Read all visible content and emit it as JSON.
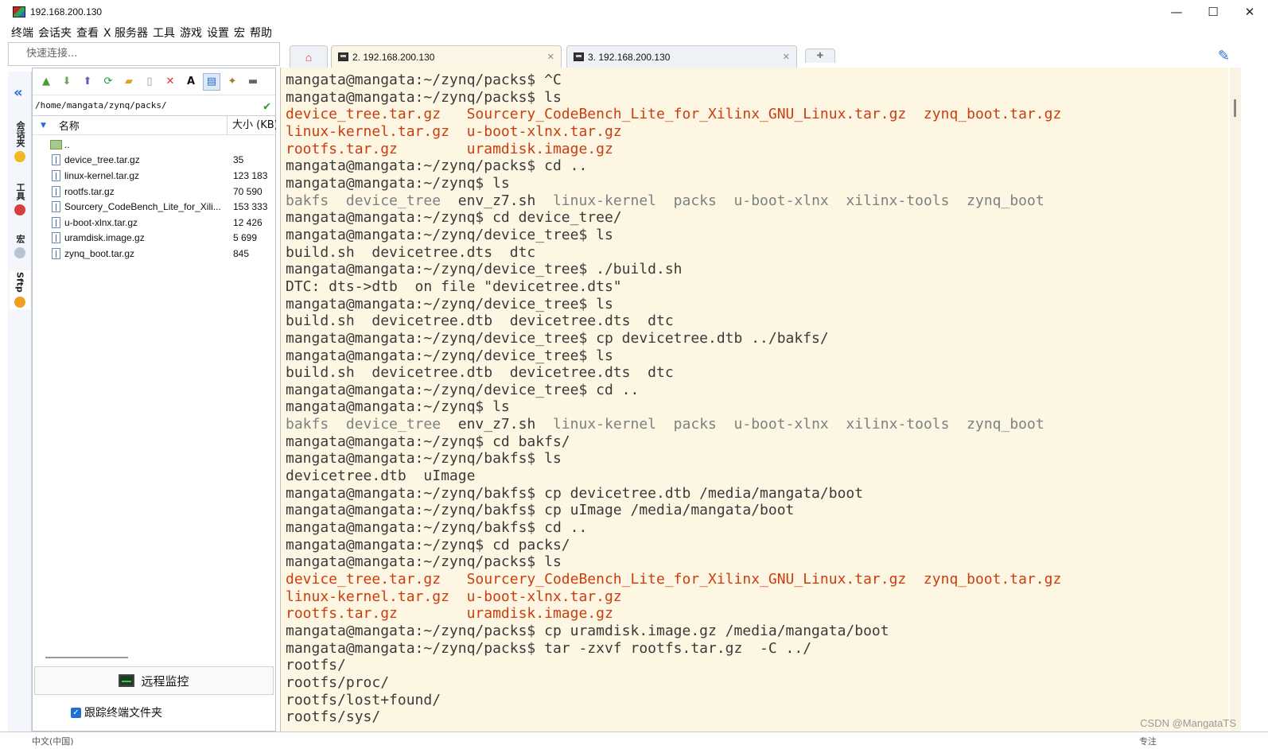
{
  "window": {
    "title": "192.168.200.130",
    "minimize": "—",
    "maximize": "☐",
    "close": "✕"
  },
  "menu": [
    "终端",
    "会话夹",
    "查看",
    "X 服务器",
    "工具",
    "游戏",
    "设置",
    "宏",
    "帮助"
  ],
  "quick_connect": {
    "placeholder": "快速连接..."
  },
  "tabs": [
    {
      "label": "",
      "icon": "home-icon"
    },
    {
      "label": "2. 192.168.200.130",
      "active": true
    },
    {
      "label": "3. 192.168.200.130"
    },
    {
      "label": "",
      "icon": "new-tab-icon"
    }
  ],
  "side_strip": [
    "会话夹",
    "工具",
    "宏",
    "Sftp"
  ],
  "sftp": {
    "path": "/home/mangata/zynq/packs/",
    "columns": {
      "name": "名称",
      "size": "大小 (KB)"
    },
    "parent": "..",
    "files": [
      {
        "name": "device_tree.tar.gz",
        "size": "35"
      },
      {
        "name": "linux-kernel.tar.gz",
        "size": "123 183"
      },
      {
        "name": "rootfs.tar.gz",
        "size": "70 590"
      },
      {
        "name": "Sourcery_CodeBench_Lite_for_Xili...",
        "size": "153 333"
      },
      {
        "name": "u-boot-xlnx.tar.gz",
        "size": "12 426"
      },
      {
        "name": "uramdisk.image.gz",
        "size": "5 699"
      },
      {
        "name": "zynq_boot.tar.gz",
        "size": "845"
      }
    ],
    "monitor_label": "远程监控",
    "follow_label": "跟踪终端文件夹"
  },
  "terminal_lines": [
    [
      [
        "",
        "mangata@mangata:~/zynq/packs$ ^C"
      ]
    ],
    [
      [
        "",
        "mangata@mangata:~/zynq/packs$ ls"
      ]
    ],
    [
      [
        "r",
        "device_tree.tar.gz   Sourcery_CodeBench_Lite_for_Xilinx_GNU_Linux.tar.gz  zynq_boot.tar.gz"
      ]
    ],
    [
      [
        "r",
        "linux-kernel.tar.gz  u-boot-xlnx.tar.gz"
      ]
    ],
    [
      [
        "r",
        "rootfs.tar.gz        uramdisk.image.gz"
      ]
    ],
    [
      [
        "",
        "mangata@mangata:~/zynq/packs$ cd .."
      ]
    ],
    [
      [
        "",
        "mangata@mangata:~/zynq$ ls"
      ]
    ],
    [
      [
        "g",
        "bakfs  device_tree  "
      ],
      [
        "",
        "env_z7.sh  "
      ],
      [
        "g",
        "linux-kernel  packs  u-boot-xlnx  xilinx-tools  zynq_boot"
      ]
    ],
    [
      [
        "",
        "mangata@mangata:~/zynq$ cd device_tree/"
      ]
    ],
    [
      [
        "",
        "mangata@mangata:~/zynq/device_tree$ ls"
      ]
    ],
    [
      [
        "",
        "build.sh  devicetree.dts  dtc"
      ]
    ],
    [
      [
        "",
        "mangata@mangata:~/zynq/device_tree$ ./build.sh"
      ]
    ],
    [
      [
        "",
        "DTC: dts->dtb  on file \"devicetree.dts\""
      ]
    ],
    [
      [
        "",
        "mangata@mangata:~/zynq/device_tree$ ls"
      ]
    ],
    [
      [
        "",
        "build.sh  devicetree.dtb  devicetree.dts  dtc"
      ]
    ],
    [
      [
        "",
        "mangata@mangata:~/zynq/device_tree$ cp devicetree.dtb ../bakfs/"
      ]
    ],
    [
      [
        "",
        "mangata@mangata:~/zynq/device_tree$ ls"
      ]
    ],
    [
      [
        "",
        "build.sh  devicetree.dtb  devicetree.dts  dtc"
      ]
    ],
    [
      [
        "",
        "mangata@mangata:~/zynq/device_tree$ cd .."
      ]
    ],
    [
      [
        "",
        "mangata@mangata:~/zynq$ ls"
      ]
    ],
    [
      [
        "g",
        "bakfs  device_tree  "
      ],
      [
        "",
        "env_z7.sh  "
      ],
      [
        "g",
        "linux-kernel  packs  u-boot-xlnx  xilinx-tools  zynq_boot"
      ]
    ],
    [
      [
        "",
        "mangata@mangata:~/zynq$ cd bakfs/"
      ]
    ],
    [
      [
        "",
        "mangata@mangata:~/zynq/bakfs$ ls"
      ]
    ],
    [
      [
        "",
        "devicetree.dtb  uImage"
      ]
    ],
    [
      [
        "",
        "mangata@mangata:~/zynq/bakfs$ cp devicetree.dtb /media/mangata/boot"
      ]
    ],
    [
      [
        "",
        "mangata@mangata:~/zynq/bakfs$ cp uImage /media/mangata/boot"
      ]
    ],
    [
      [
        "",
        "mangata@mangata:~/zynq/bakfs$ cd .."
      ]
    ],
    [
      [
        "",
        "mangata@mangata:~/zynq$ cd packs/"
      ]
    ],
    [
      [
        "",
        "mangata@mangata:~/zynq/packs$ ls"
      ]
    ],
    [
      [
        "r",
        "device_tree.tar.gz   Sourcery_CodeBench_Lite_for_Xilinx_GNU_Linux.tar.gz  zynq_boot.tar.gz"
      ]
    ],
    [
      [
        "r",
        "linux-kernel.tar.gz  u-boot-xlnx.tar.gz"
      ]
    ],
    [
      [
        "r",
        "rootfs.tar.gz        uramdisk.image.gz"
      ]
    ],
    [
      [
        "",
        "mangata@mangata:~/zynq/packs$ cp uramdisk.image.gz /media/mangata/boot"
      ]
    ],
    [
      [
        "",
        "mangata@mangata:~/zynq/packs$ tar -zxvf rootfs.tar.gz  -C ../"
      ]
    ],
    [
      [
        "",
        "rootfs/"
      ]
    ],
    [
      [
        "",
        "rootfs/proc/"
      ]
    ],
    [
      [
        "",
        "rootfs/lost+found/"
      ]
    ],
    [
      [
        "",
        "rootfs/sys/"
      ]
    ]
  ],
  "status": {
    "left": "中文(中国)",
    "right": "专注"
  },
  "watermark": "CSDN @MangataTS",
  "colors": {
    "terminal_bg": "#fdf6e3",
    "dir_red": "#cb3d0e",
    "dir_gray": "#7a8282",
    "accent": "#2a6ad0"
  }
}
